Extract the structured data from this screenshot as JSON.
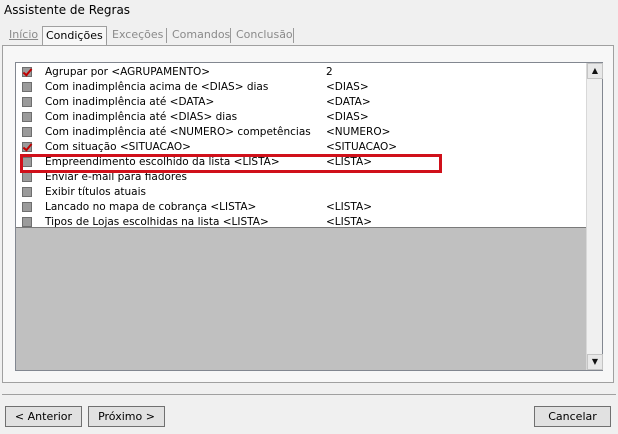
{
  "window": {
    "title": "Assistente de Regras"
  },
  "tabs": [
    {
      "label": "Início",
      "active": false,
      "enabled": true
    },
    {
      "label": "Condições",
      "active": true,
      "enabled": true
    },
    {
      "label": "Exceções",
      "active": false,
      "enabled": false
    },
    {
      "label": "Comandos",
      "active": false,
      "enabled": false
    },
    {
      "label": "Conclusão",
      "active": false,
      "enabled": false
    }
  ],
  "conditions": [
    {
      "label": "Agrupar por <AGRUPAMENTO>",
      "value": "2",
      "checked": true
    },
    {
      "label": "Com inadimplência acima de <DIAS> dias",
      "value": "<DIAS>",
      "checked": false
    },
    {
      "label": "Com inadimplência até <DATA>",
      "value": "<DATA>",
      "checked": false
    },
    {
      "label": "Com inadimplência até <DIAS>  dias",
      "value": "<DIAS>",
      "checked": false
    },
    {
      "label": "Com inadimplência até <NUMERO> competências",
      "value": "<NUMERO>",
      "checked": false
    },
    {
      "label": "Com situação <SITUACAO>",
      "value": "<SITUACAO>",
      "checked": true,
      "highlighted": true
    },
    {
      "label": "Empreendimento escolhido da lista <LISTA>",
      "value": "<LISTA>",
      "checked": false
    },
    {
      "label": "Enviar e-mail para fiadores",
      "value": "",
      "checked": false
    },
    {
      "label": "Exibir títulos atuais",
      "value": "",
      "checked": false
    },
    {
      "label": "Lancado no mapa de cobrança <LISTA>",
      "value": "<LISTA>",
      "checked": false
    },
    {
      "label": "Tipos de Lojas escolhidas na lista <LISTA>",
      "value": "<LISTA>",
      "checked": false
    }
  ],
  "scrollbar": {
    "up_icon": "▲",
    "down_icon": "▼"
  },
  "buttons": {
    "back": {
      "label": "Anterior",
      "icon": "<"
    },
    "next": {
      "label": "Próximo",
      "icon": ">"
    },
    "cancel": {
      "label": "Cancelar"
    }
  },
  "colors": {
    "highlight": "#d0101a",
    "check": "#c00000"
  }
}
